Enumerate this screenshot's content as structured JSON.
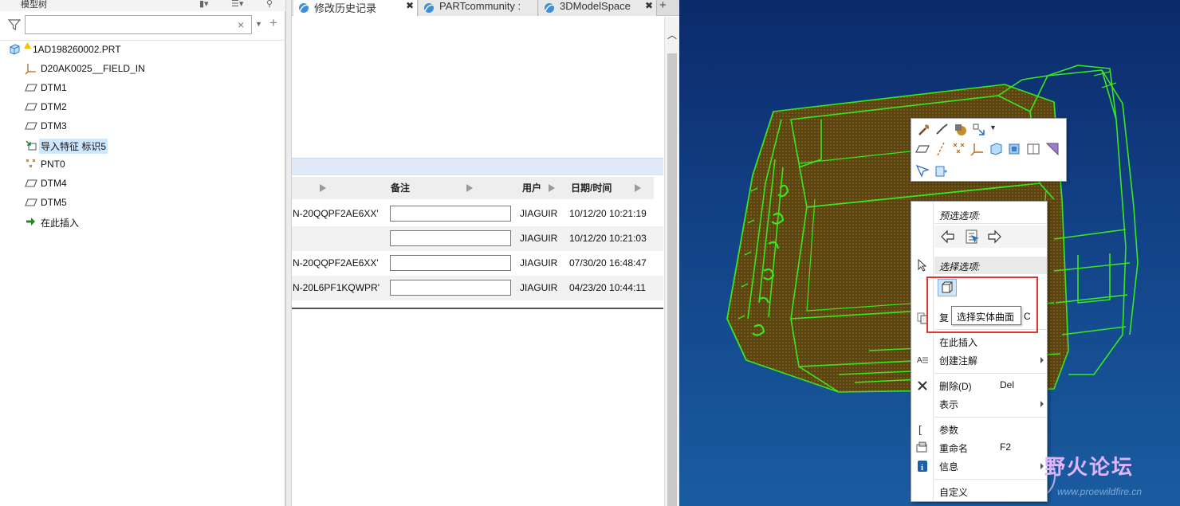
{
  "model_tree": {
    "title": "模型树",
    "search": {
      "value": "",
      "placeholder": ""
    },
    "items": [
      {
        "label": "1AD198260002.PRT",
        "icon": "part-icon"
      },
      {
        "label": "D20AK0025__FIELD_IN",
        "icon": "csys-icon"
      },
      {
        "label": "DTM1",
        "icon": "datum-plane-icon"
      },
      {
        "label": "DTM2",
        "icon": "datum-plane-icon"
      },
      {
        "label": "DTM3",
        "icon": "datum-plane-icon"
      },
      {
        "label": "导入特征 标识5",
        "icon": "import-feature-icon",
        "selected": true
      },
      {
        "label": "PNT0",
        "icon": "datum-point-icon"
      },
      {
        "label": "DTM4",
        "icon": "datum-plane-icon"
      },
      {
        "label": "DTM5",
        "icon": "datum-plane-icon"
      },
      {
        "label": "在此插入",
        "icon": "insert-arrow-icon"
      }
    ]
  },
  "browser": {
    "tabs": [
      {
        "label": "修改历史记录",
        "active": true
      },
      {
        "label": "PARTcommunity :"
      },
      {
        "label": "3DModelSpace"
      }
    ],
    "history": {
      "headers": {
        "note": "备注",
        "user": "用户",
        "date": "日期/时间"
      },
      "rows": [
        {
          "id": "N-20QQPF2AE6XX'",
          "note": "",
          "user": "JIAGUIR",
          "date": "10/12/20 10:21:19"
        },
        {
          "id": "",
          "note": "",
          "user": "JIAGUIR",
          "date": "10/12/20 10:21:03"
        },
        {
          "id": "N-20QQPF2AE6XX'",
          "note": "",
          "user": "JIAGUIR",
          "date": "07/30/20 16:48:47"
        },
        {
          "id": "N-20L6PF1KQWPR'",
          "note": "",
          "user": "JIAGUIR",
          "date": "04/23/20 10:44:11"
        }
      ]
    }
  },
  "mini_toolbar": {
    "row1": [
      "appearance-icon",
      "chain-icon",
      "render-icon",
      "select-filter-icon"
    ],
    "row2": [
      "datum-plane-icon",
      "datum-axis-icon",
      "datum-point-icon",
      "csys-icon",
      "solid-icon",
      "surface-icon",
      "view-icon",
      "section-icon"
    ],
    "row3": [
      "query-select-icon",
      "smart-select-icon"
    ]
  },
  "context_menu": {
    "preselect_title": "预选选项:",
    "select_title": "选择选项:",
    "copy_label": "复",
    "copy_key": "C",
    "items": [
      {
        "label": "在此插入",
        "key": "",
        "submenu": false
      },
      {
        "label": "创建注解",
        "key": "",
        "submenu": true
      },
      {
        "label": "删除(D)",
        "key": "Del",
        "submenu": false
      },
      {
        "label": "表示",
        "key": "",
        "submenu": true
      },
      {
        "label": "参数",
        "key": "",
        "submenu": false
      },
      {
        "label": "重命名",
        "key": "F2",
        "submenu": false
      },
      {
        "label": "信息",
        "key": "",
        "submenu": true
      },
      {
        "label": "自定义",
        "key": "",
        "submenu": false
      }
    ],
    "tooltip": "选择实体曲面"
  },
  "colors": {
    "model_wire": "#39e81c",
    "highlight_box": "#e23232",
    "selection": "#cde8ff"
  },
  "watermark": {
    "text": "野火论坛",
    "url": "www.proewildfire.cn"
  }
}
